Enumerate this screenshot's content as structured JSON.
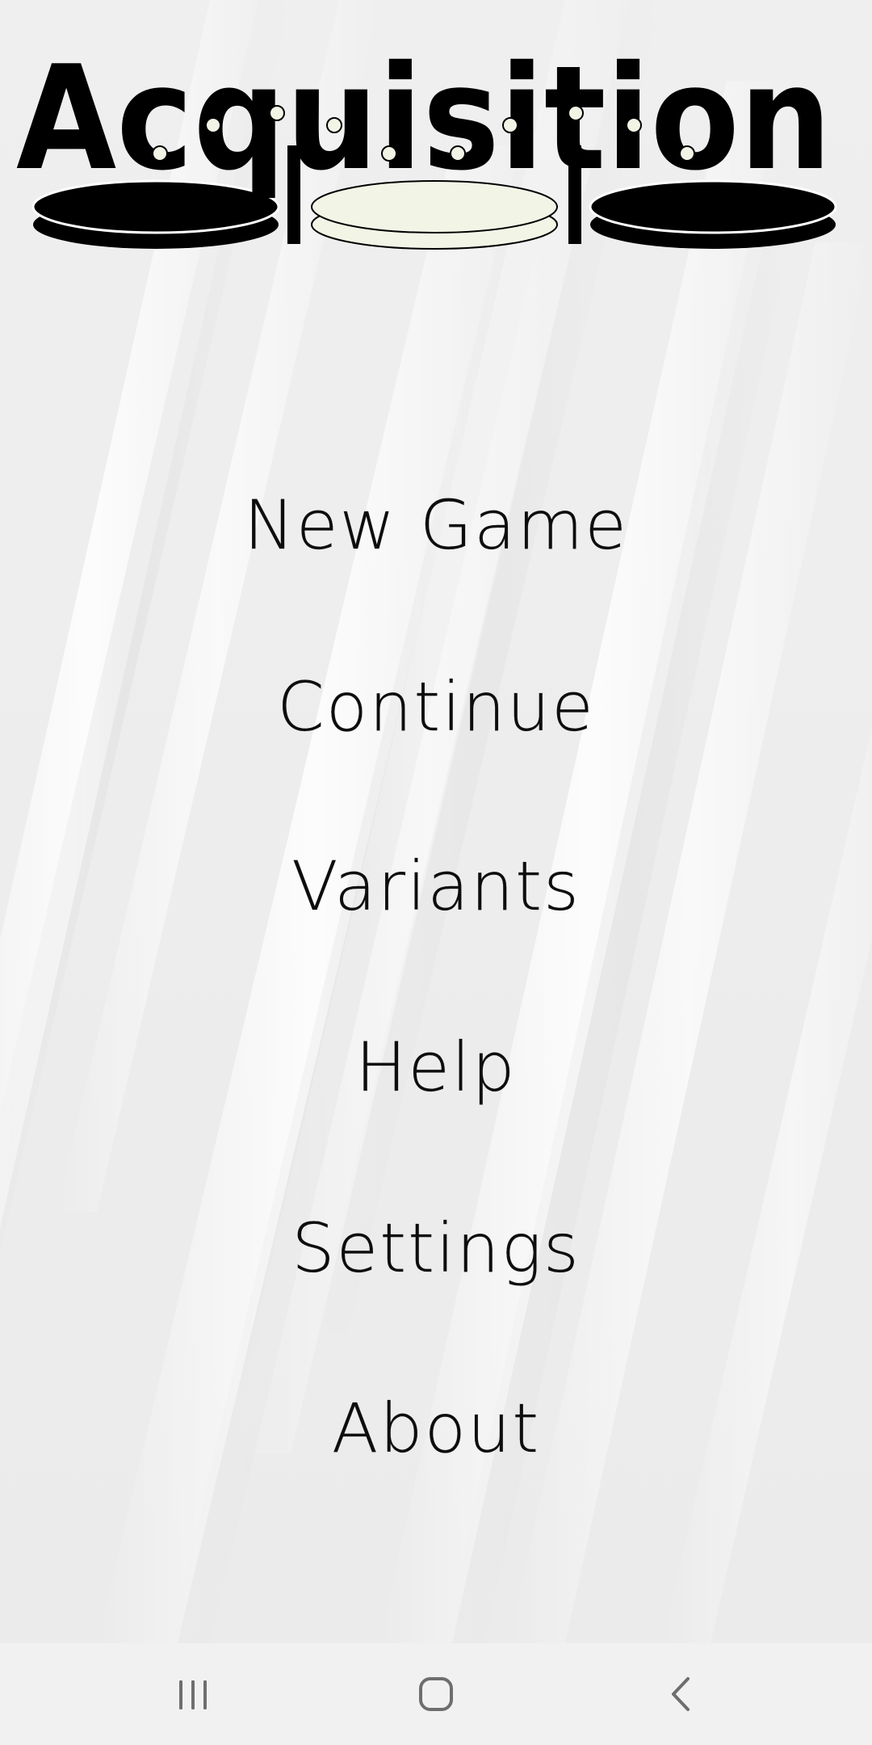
{
  "app": {
    "title": "Acquisition"
  },
  "menu": {
    "items": [
      {
        "label": "New Game"
      },
      {
        "label": "Continue"
      },
      {
        "label": "Variants"
      },
      {
        "label": "Help"
      },
      {
        "label": "Settings"
      },
      {
        "label": "About"
      }
    ]
  },
  "navbar": {
    "buttons": [
      {
        "icon": "recent-apps-icon"
      },
      {
        "icon": "home-icon"
      },
      {
        "icon": "back-icon"
      }
    ]
  },
  "colors": {
    "background": "#ececec",
    "text": "#0d0d0d",
    "logo_black": "#000000",
    "logo_cream": "#f2f5e6",
    "navbar": "#f1f1f1",
    "nav_icon": "#6e6e6e"
  }
}
